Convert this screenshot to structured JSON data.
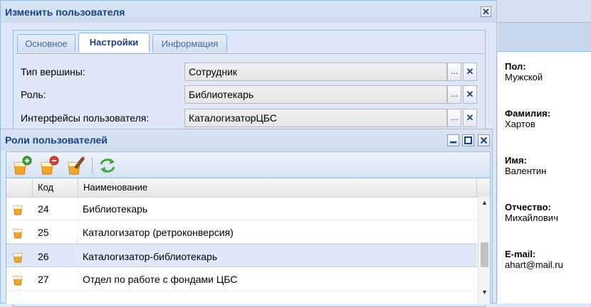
{
  "background_panel": {
    "fields": [
      {
        "label": "Пол:",
        "value": "Мужской"
      },
      {
        "label": "Фамилия:",
        "value": "Хартов"
      },
      {
        "label": "Имя:",
        "value": "Валентин"
      },
      {
        "label": "Отчество:",
        "value": "Михайлович"
      },
      {
        "label": "E-mail:",
        "value": "ahart@mail.ru"
      }
    ]
  },
  "edit_window": {
    "title": "Изменить пользователя",
    "close_symbol": "✕",
    "tabs": [
      {
        "label": "Основное",
        "active": false
      },
      {
        "label": "Настройки",
        "active": true
      },
      {
        "label": "Информация",
        "active": false
      }
    ],
    "fields": [
      {
        "label": "Тип вершины:",
        "value": "Сотрудник"
      },
      {
        "label": "Роль:",
        "value": "Библиотекарь"
      },
      {
        "label": "Интерфейсы пользователя:",
        "value": "КаталогизаторЦБС"
      }
    ],
    "trigger_symbol": "...",
    "clear_symbol": "✕"
  },
  "roles_window": {
    "title": "Роли пользователей",
    "toolbar_icons": [
      "add-role-icon",
      "remove-role-icon",
      "edit-role-icon",
      "refresh-icon"
    ],
    "columns": [
      "Код",
      "Наименование"
    ],
    "rows": [
      {
        "code": "24",
        "name": "Библиотекарь",
        "selected": false
      },
      {
        "code": "25",
        "name": "Каталогизатор (ретроконверсия)",
        "selected": false
      },
      {
        "code": "26",
        "name": "Каталогизатор-библиотекарь",
        "selected": true
      },
      {
        "code": "27",
        "name": "Отдел по работе с фондами ЦБС",
        "selected": false
      }
    ],
    "colors": {
      "accent": "#15428b",
      "selection": "#dfe8f6",
      "border": "#99bbe8"
    }
  }
}
